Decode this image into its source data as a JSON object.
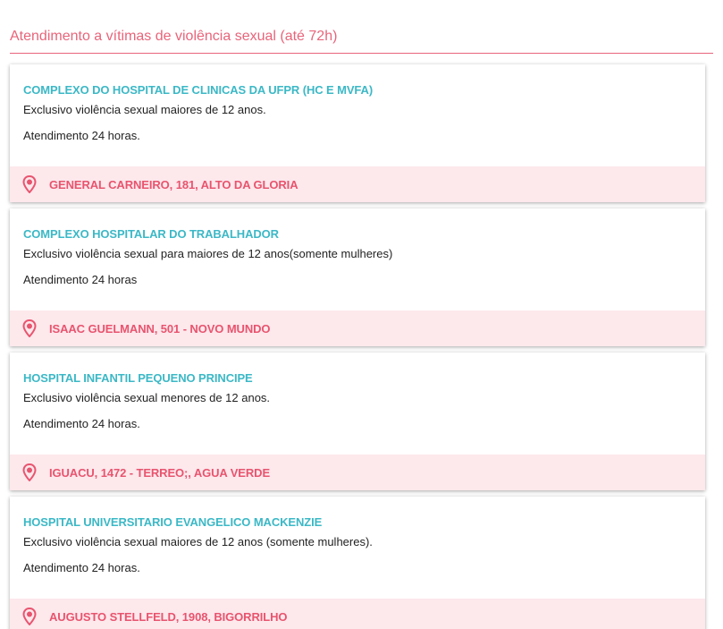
{
  "section": {
    "title": "Atendimento a vítimas de violência sexual (até 72h)"
  },
  "colors": {
    "accent": "#e8647a",
    "name": "#3bb8c6",
    "address_bg": "#fde8ec",
    "address_text": "#e8546e"
  },
  "icons": {
    "address": "map-pin-icon"
  },
  "cards": [
    {
      "name": "COMPLEXO DO HOSPITAL DE CLINICAS DA UFPR (HC E MVFA)",
      "description": "Exclusivo violência sexual maiores de 12 anos.",
      "hours": "Atendimento 24 horas.",
      "address": "GENERAL CARNEIRO, 181, ALTO DA GLORIA"
    },
    {
      "name": "COMPLEXO HOSPITALAR DO TRABALHADOR",
      "description": "Exclusivo violência sexual para maiores de 12 anos(somente mulheres)",
      "hours": "Atendimento 24 horas",
      "address": "ISAAC GUELMANN, 501 - NOVO MUNDO"
    },
    {
      "name": "HOSPITAL INFANTIL PEQUENO PRINCIPE",
      "description": "Exclusivo violência sexual menores de 12 anos.",
      "hours": "Atendimento 24 horas.",
      "address": "IGUACU, 1472 - TERREO;, AGUA VERDE"
    },
    {
      "name": "HOSPITAL UNIVERSITARIO EVANGELICO MACKENZIE",
      "description": "Exclusivo violência sexual maiores de 12 anos (somente mulheres).",
      "hours": "Atendimento 24 horas.",
      "address": "AUGUSTO STELLFELD, 1908, BIGORRILHO"
    }
  ]
}
